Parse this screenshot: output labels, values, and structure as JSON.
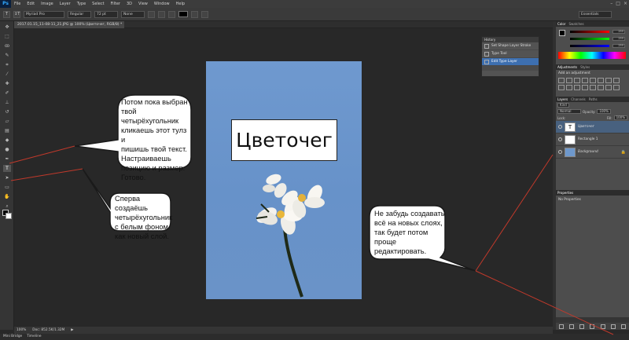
{
  "app": {
    "logo": "Ps"
  },
  "menu": [
    "File",
    "Edit",
    "Image",
    "Layer",
    "Type",
    "Select",
    "Filter",
    "3D",
    "View",
    "Window",
    "Help"
  ],
  "window_controls": [
    "–",
    "□",
    "×"
  ],
  "options_bar": {
    "tool_glyph": "T",
    "orientation_glyph": "↕T",
    "font_family": "Myriad Pro",
    "font_style": "Regular",
    "font_size": "72 pt",
    "antialias": "None",
    "workspace": "Essentials"
  },
  "document": {
    "tab_title": "2017.01.15_11-08-11_21.JPG @ 100% (Цветочег, RGB/8) *"
  },
  "canvas": {
    "title_text": "Цветочег"
  },
  "history_panel": {
    "title": "History",
    "items": [
      {
        "label": "Set Shape Layer Stroke",
        "active": false
      },
      {
        "label": "Type Tool",
        "active": false
      },
      {
        "label": "Edit Type Layer",
        "active": true
      }
    ]
  },
  "color_panel": {
    "tabs": [
      "Color",
      "Swatches"
    ],
    "values": [
      "255",
      "255",
      "255"
    ],
    "slider_colors": [
      "#e03030",
      "#30c030",
      "#3060e0"
    ]
  },
  "adjustments_panel": {
    "tabs": [
      "Adjustments",
      "Styles"
    ],
    "title": "Add an adjustment"
  },
  "layers_panel": {
    "tabs": [
      "Layers",
      "Channels",
      "Paths"
    ],
    "filter_kind": "Kind",
    "blend_mode": "Normal",
    "opacity_label": "Opacity:",
    "opacity": "100%",
    "lock_label": "Lock:",
    "fill_label": "Fill:",
    "fill": "100%",
    "layers": [
      {
        "name": "Цветочег",
        "thumb": "T",
        "active": true
      },
      {
        "name": "Rectangle 1",
        "thumb": "",
        "active": false
      },
      {
        "name": "Background",
        "thumb": "",
        "active": false
      }
    ]
  },
  "properties_panel": {
    "title": "Properties",
    "text": "No Properties"
  },
  "status_bar": {
    "zoom": "100%",
    "doc_info": "Doc: 852.5K/1.32M"
  },
  "bottom_tabs": [
    "Mini Bridge",
    "Timeline"
  ],
  "callouts": [
    {
      "text": "Потом пока выбран\nтвой\nчетырёхугольник\nкликаешь этот тулз и\nпишишь твой текст.\nНастраиваешь\nпозицию и размер.\nГотово."
    },
    {
      "text": "Сперва создаёшь\nчетырёхугольник\nс белым фоном\nкак новый слой."
    },
    {
      "text": "Не забудь создавать\nвсё на новых слоях,\nтак будет потом\nпроще\nредактировать."
    }
  ]
}
